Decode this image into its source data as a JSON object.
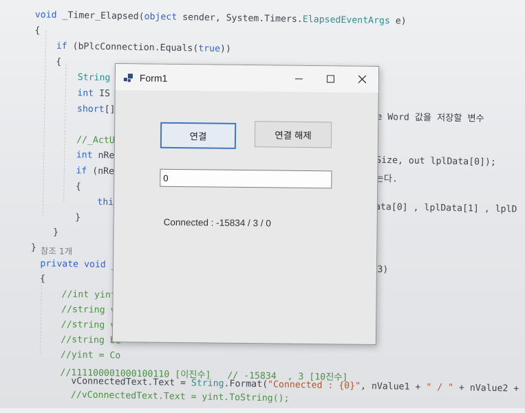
{
  "code": {
    "lines": [
      {
        "segs": [
          {
            "t": "void",
            "c": "kw"
          },
          {
            "t": " _Timer_Elapsed(",
            "c": ""
          },
          {
            "t": "object",
            "c": "kw"
          },
          {
            "t": " sender, System.Timers.",
            "c": ""
          },
          {
            "t": "ElapsedEventArgs",
            "c": "ty"
          },
          {
            "t": " e)",
            "c": ""
          }
        ]
      },
      {
        "segs": [
          {
            "t": "{",
            "c": ""
          }
        ]
      },
      {
        "segs": [
          {
            "t": "    ",
            "c": ""
          },
          {
            "t": "if",
            "c": "kw"
          },
          {
            "t": " (bPlcConnection.Equals(",
            "c": ""
          },
          {
            "t": "true",
            "c": "kw"
          },
          {
            "t": "))",
            "c": ""
          }
        ]
      },
      {
        "segs": [
          {
            "t": "    {",
            "c": ""
          }
        ]
      },
      {
        "segs": [
          {
            "t": "        ",
            "c": ""
          },
          {
            "t": "String",
            "c": "ty"
          }
        ]
      },
      {
        "segs": [
          {
            "t": "        ",
            "c": ""
          },
          {
            "t": "int",
            "c": "kw"
          },
          {
            "t": " IS",
            "c": ""
          }
        ]
      },
      {
        "segs": [
          {
            "t": "        ",
            "c": ""
          },
          {
            "t": "short",
            "c": "kw"
          },
          {
            "t": "[]",
            "c": ""
          }
        ]
      },
      {
        "segs": [
          {
            "t": "",
            "c": ""
          }
        ]
      },
      {
        "segs": [
          {
            "t": "        ",
            "c": ""
          },
          {
            "t": "//_ActU",
            "c": "cm"
          }
        ]
      },
      {
        "segs": [
          {
            "t": "        ",
            "c": ""
          },
          {
            "t": "int",
            "c": "kw"
          },
          {
            "t": " nRe",
            "c": ""
          }
        ]
      },
      {
        "segs": [
          {
            "t": "        ",
            "c": ""
          },
          {
            "t": "if",
            "c": "kw"
          },
          {
            "t": " (nRe",
            "c": ""
          }
        ]
      },
      {
        "segs": [
          {
            "t": "        {",
            "c": ""
          }
        ]
      },
      {
        "segs": [
          {
            "t": "            ",
            "c": ""
          },
          {
            "t": "thi",
            "c": "kw"
          }
        ]
      },
      {
        "segs": [
          {
            "t": "        }",
            "c": ""
          }
        ]
      },
      {
        "segs": [
          {
            "t": "    }",
            "c": ""
          }
        ]
      },
      {
        "segs": [
          {
            "t": "}",
            "c": ""
          }
        ]
      }
    ],
    "right_fragments": [
      {
        "text": "e Word 값을 저장할 변수",
        "row": 6
      },
      {
        "text": "Size, out lplData[0]);",
        "row": 9
      },
      {
        "text": "는다.",
        "row": 10
      },
      {
        "text": "ata[0] , lplData[1] , lplD",
        "row": 12
      }
    ],
    "lower": [
      {
        "segs": [
          {
            "t": "참조 1개",
            "c": "ref"
          }
        ]
      },
      {
        "segs": [
          {
            "t": "private",
            "c": "kw"
          },
          {
            "t": " ",
            "c": ""
          },
          {
            "t": "void",
            "c": "kw"
          },
          {
            "t": " _S",
            "c": ""
          }
        ]
      },
      {
        "segs": [
          {
            "t": "{",
            "c": ""
          }
        ]
      },
      {
        "segs": [
          {
            "t": "    //int yint",
            "c": "cm"
          }
        ]
      },
      {
        "segs": [
          {
            "t": "    //string va",
            "c": "cm"
          }
        ]
      },
      {
        "segs": [
          {
            "t": "    //string va",
            "c": "cm"
          }
        ]
      },
      {
        "segs": [
          {
            "t": "    //string bi",
            "c": "cm"
          }
        ]
      },
      {
        "segs": [
          {
            "t": "    //yint = Co",
            "c": "cm"
          }
        ]
      },
      {
        "segs": [
          {
            "t": "    //111100001000100110 [이진수]   // -15834  , 3 [10진수]",
            "c": "cm"
          }
        ]
      }
    ],
    "lower_right": "3)",
    "bottom": [
      {
        "segs": [
          {
            "t": "    vConnectedText.Text = ",
            "c": ""
          },
          {
            "t": "String",
            "c": "ty"
          },
          {
            "t": ".Format(",
            "c": ""
          },
          {
            "t": "\"Connected : {0}\"",
            "c": "str"
          },
          {
            "t": ", nValue1 + ",
            "c": ""
          },
          {
            "t": "\" / \"",
            "c": "str"
          },
          {
            "t": " + nValue2 + ",
            "c": ""
          },
          {
            "t": "\"",
            "c": "str"
          }
        ]
      },
      {
        "segs": [
          {
            "t": "    //vConnectedText.Text = yint.ToString();",
            "c": "cm"
          }
        ]
      }
    ]
  },
  "form": {
    "title": "Form1",
    "connect_label": "연결",
    "disconnect_label": "연결 해제",
    "input_value": "0",
    "status_text": "Connected : -15834 / 3 / 0"
  },
  "icons": {
    "app": "app-icon",
    "minimize": "minimize-icon",
    "maximize": "maximize-icon",
    "close": "close-icon"
  }
}
